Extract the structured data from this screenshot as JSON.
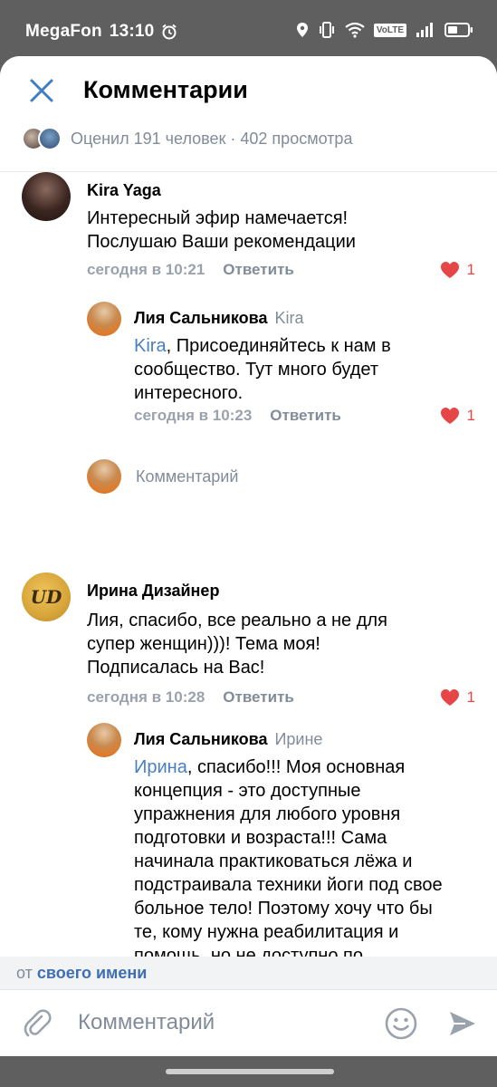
{
  "status_bar": {
    "carrier": "MegaFon",
    "time": "13:10",
    "volte": "VoLTE"
  },
  "header": {
    "title": "Комментарии",
    "likers_text": "Оценил 191 человек · 402 просмотра"
  },
  "comments": [
    {
      "author": "Kira Yaga",
      "text": "Интересный эфир намечается! Послушаю Ваши рекомендации",
      "date": "сегодня в 10:21",
      "reply_label": "Ответить",
      "likes": "1"
    },
    {
      "author": "Лия Сальникова",
      "reply_to": "Kira",
      "mention": "Kira",
      "text": ", Присоединяйтесь к нам в сообщество. Тут много будет интересного.",
      "date": "сегодня в 10:23",
      "reply_label": "Ответить",
      "likes": "1"
    },
    {
      "author": "Ирина Дизайнер",
      "avatar_text": "UD",
      "text": "Лия, спасибо, все реально а не для супер женщин)))! Тема моя! Подписалась на Вас!",
      "date": "сегодня в 10:28",
      "reply_label": "Ответить",
      "likes": "1"
    },
    {
      "author": "Лия Сальникова",
      "reply_to": "Ирине",
      "mention": "Ирина",
      "text": ", спасибо!!! Моя основная концепция - это доступные упражнения для любого уровня подготовки и возраста!!! Сама начинала практиковаться лёжа и подстраивала техники йоги под свое больное тело! Поэтому хочу что бы те, кому нужна реабилитация и помощь, но не доступно по удаленности или"
    }
  ],
  "thread_reply_placeholder": "Комментарий",
  "from_bar": {
    "prefix": "от",
    "link": "своего имени"
  },
  "composer": {
    "placeholder": "Комментарий"
  },
  "colors": {
    "accent": "#4a7fbf",
    "like_red": "#e64646",
    "secondary_text": "#818c99"
  }
}
